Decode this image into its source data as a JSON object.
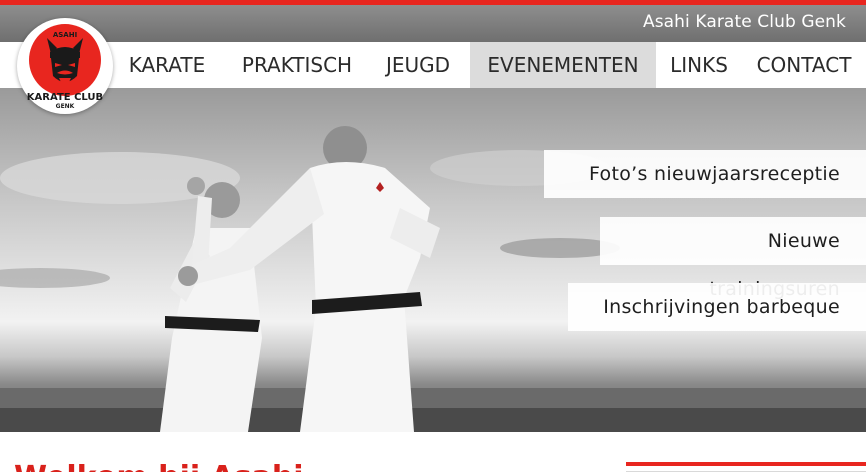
{
  "header": {
    "site_title": "Asahi Karate Club Genk",
    "accent_color": "#e8261f"
  },
  "logo": {
    "top_text": "ASAHI",
    "main_text": "KARATE CLUB",
    "sub_text": "GENK",
    "icon": "samurai-mask-icon"
  },
  "nav": {
    "items": [
      {
        "label": "KARATE"
      },
      {
        "label": "PRAKTISCH"
      },
      {
        "label": "JEUGD"
      },
      {
        "label": "EVENEMENTEN",
        "active": true
      },
      {
        "label": "LINKS"
      },
      {
        "label": "CONTACT"
      }
    ]
  },
  "hero": {
    "news": [
      {
        "label": "Foto’s nieuwjaarsreceptie"
      },
      {
        "label": "Nieuwe trainingsuren"
      },
      {
        "label": "Inschrijvingen barbeque"
      }
    ]
  },
  "main": {
    "welcome_heading": "Welkom bij Asahi"
  }
}
